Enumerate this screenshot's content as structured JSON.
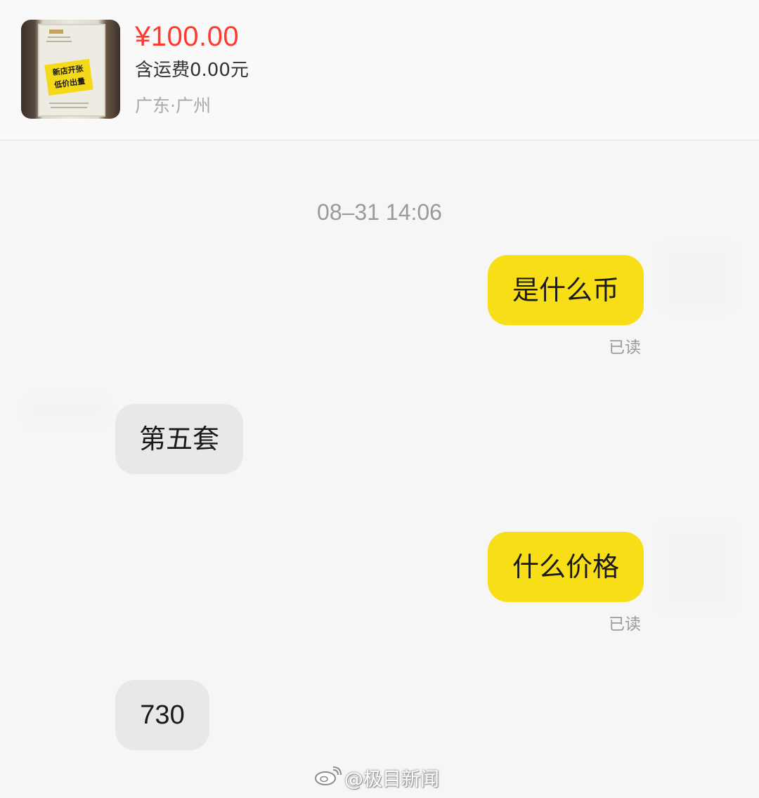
{
  "product": {
    "price": "¥100.00",
    "shipping": "含运费0.00元",
    "location": "广东·广州",
    "thumbnail": {
      "sticker_line1": "新店开张",
      "sticker_line2": "低价出量"
    }
  },
  "chat": {
    "timestamp": "08–31 14:06",
    "messages": [
      {
        "from": "me",
        "text": "是什么币",
        "status": "已读"
      },
      {
        "from": "them",
        "text": "第五套"
      },
      {
        "from": "me",
        "text": "什么价格",
        "status": "已读"
      },
      {
        "from": "them",
        "text": "730"
      }
    ]
  },
  "watermark": {
    "text": "@极目新闻",
    "icon": "weibo-icon"
  },
  "colors": {
    "price_red": "#ff3b30",
    "my_bubble": "#f8de17",
    "their_bubble": "#e8e8ea"
  }
}
